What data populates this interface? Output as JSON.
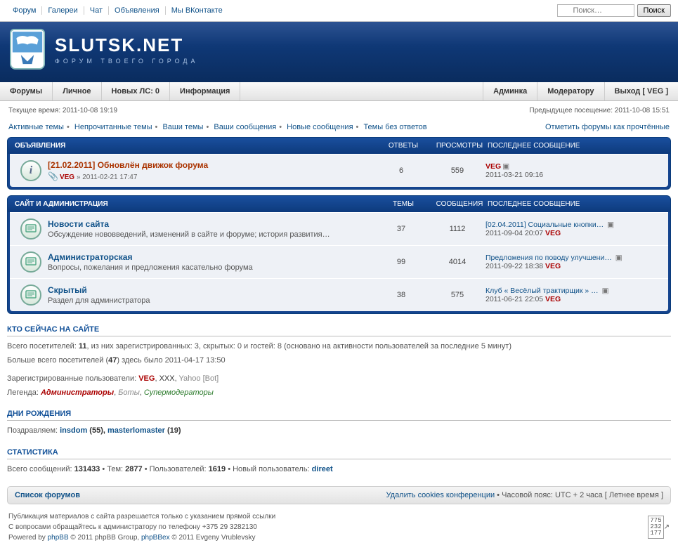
{
  "topnav": [
    "Форум",
    "Галереи",
    "Чат",
    "Объявления",
    "Мы ВКонтакте"
  ],
  "search": {
    "placeholder": "Поиск…",
    "btn": "Поиск"
  },
  "site": {
    "name": "SLUTSK.NET",
    "tag": "ФОРУМ ТВОЕГО ГОРОДА"
  },
  "nav": {
    "left": [
      "Форумы",
      "Личное",
      "Новых ЛС: 0",
      "Информация"
    ],
    "right": [
      "Админка",
      "Модератору",
      "Выход [ VEG ]"
    ]
  },
  "time": {
    "now": "Текущее время: 2011-10-08 19:19",
    "prev": "Предыдущее посещение: 2011-10-08 15:51"
  },
  "links": {
    "l": [
      "Активные темы",
      "Непрочитанные темы",
      "Ваши темы",
      "Ваши сообщения",
      "Новые сообщения",
      "Темы без ответов"
    ],
    "r": "Отметить форумы как прочтённые"
  },
  "ann": {
    "head": {
      "t": "ОБЪЯВЛЕНИЯ",
      "c1": "ОТВЕТЫ",
      "c2": "ПРОСМОТРЫ",
      "c3": "ПОСЛЕДНЕЕ СООБЩЕНИЕ"
    },
    "row": {
      "title": "[21.02.2011] Обновлён движок форума",
      "by": "VEG",
      "date": "» 2011-02-21 17:47",
      "replies": "6",
      "views": "559",
      "lp_user": "VEG",
      "lp_date": "2011-03-21 09:16"
    }
  },
  "cat": {
    "head": {
      "t": "САЙТ И АДМИНИСТРАЦИЯ",
      "c1": "ТЕМЫ",
      "c2": "СООБЩЕНИЯ",
      "c3": "ПОСЛЕДНЕЕ СООБЩЕНИЕ"
    },
    "rows": [
      {
        "title": "Новости сайта",
        "desc": "Обсуждение нововведений, изменений в сайте и форуме; история развития…",
        "topics": "37",
        "posts": "1112",
        "lp_title": "[02.04.2011] Социальные кнопки…",
        "lp_date": "2011-09-04 20:07",
        "lp_user": "VEG"
      },
      {
        "title": "Администраторская",
        "desc": "Вопросы, пожелания и предложения касательно форума",
        "topics": "99",
        "posts": "4014",
        "lp_title": "Предложения по поводу улучшени…",
        "lp_date": "2011-09-22 18:38",
        "lp_user": "VEG"
      },
      {
        "title": "Скрытый",
        "desc": "Раздел для администратора",
        "topics": "38",
        "posts": "575",
        "lp_title": "Клуб « Весёлый трактирщик » …",
        "lp_date": "2011-06-21 22:05",
        "lp_user": "VEG"
      }
    ]
  },
  "online": {
    "h": "КТО СЕЙЧАС НА САЙТЕ",
    "l1a": "Всего посетителей: ",
    "l1b": "11",
    "l1c": ", из них зарегистрированных: 3, скрытых: 0 и гостей: 8 (основано на активности пользователей за последние 5 минут)",
    "l2a": "Больше всего посетителей (",
    "l2b": "47",
    "l2c": ") здесь было 2011-04-17 13:50",
    "l3": "Зарегистрированные пользователи: ",
    "u1": "VEG",
    "u2": "XXX",
    "u3": "Yahoo [Bot]",
    "leg": "Легенда: ",
    "g1": "Администраторы",
    "g2": "Боты",
    "g3": "Супермодераторы"
  },
  "bd": {
    "h": "ДНИ РОЖДЕНИЯ",
    "pre": "Поздравляем: ",
    "u1": "insdom",
    "a1": " (55), ",
    "u2": "masterlomaster",
    "a2": " (19)"
  },
  "stats": {
    "h": "СТАТИСТИКА",
    "a": "Всего сообщений: ",
    "v1": "131433",
    "b": " • Тем: ",
    "v2": "2877",
    "c": " • Пользователей: ",
    "v3": "1619",
    "d": " • Новый пользователь: ",
    "u": "direet"
  },
  "foot": {
    "l": "Список форумов",
    "del": "Удалить cookies конференции",
    "tz": " • Часовой пояс: UTC + 2 часа [ Летнее время ]"
  },
  "credits": {
    "l1": "Публикация материалов с сайта разрешается только с указанием прямой ссылки",
    "l2": "С вопросами обращайтесь к администратору по телефону +375 29 3282130",
    "l3a": "Powered by ",
    "l3b": "phpBB",
    "l3c": " © 2011 phpBB Group, ",
    "l3d": "phpBBex",
    "l3e": " © 2011 Evgeny Vrublevsky",
    "counter": "775\n232\n177"
  }
}
